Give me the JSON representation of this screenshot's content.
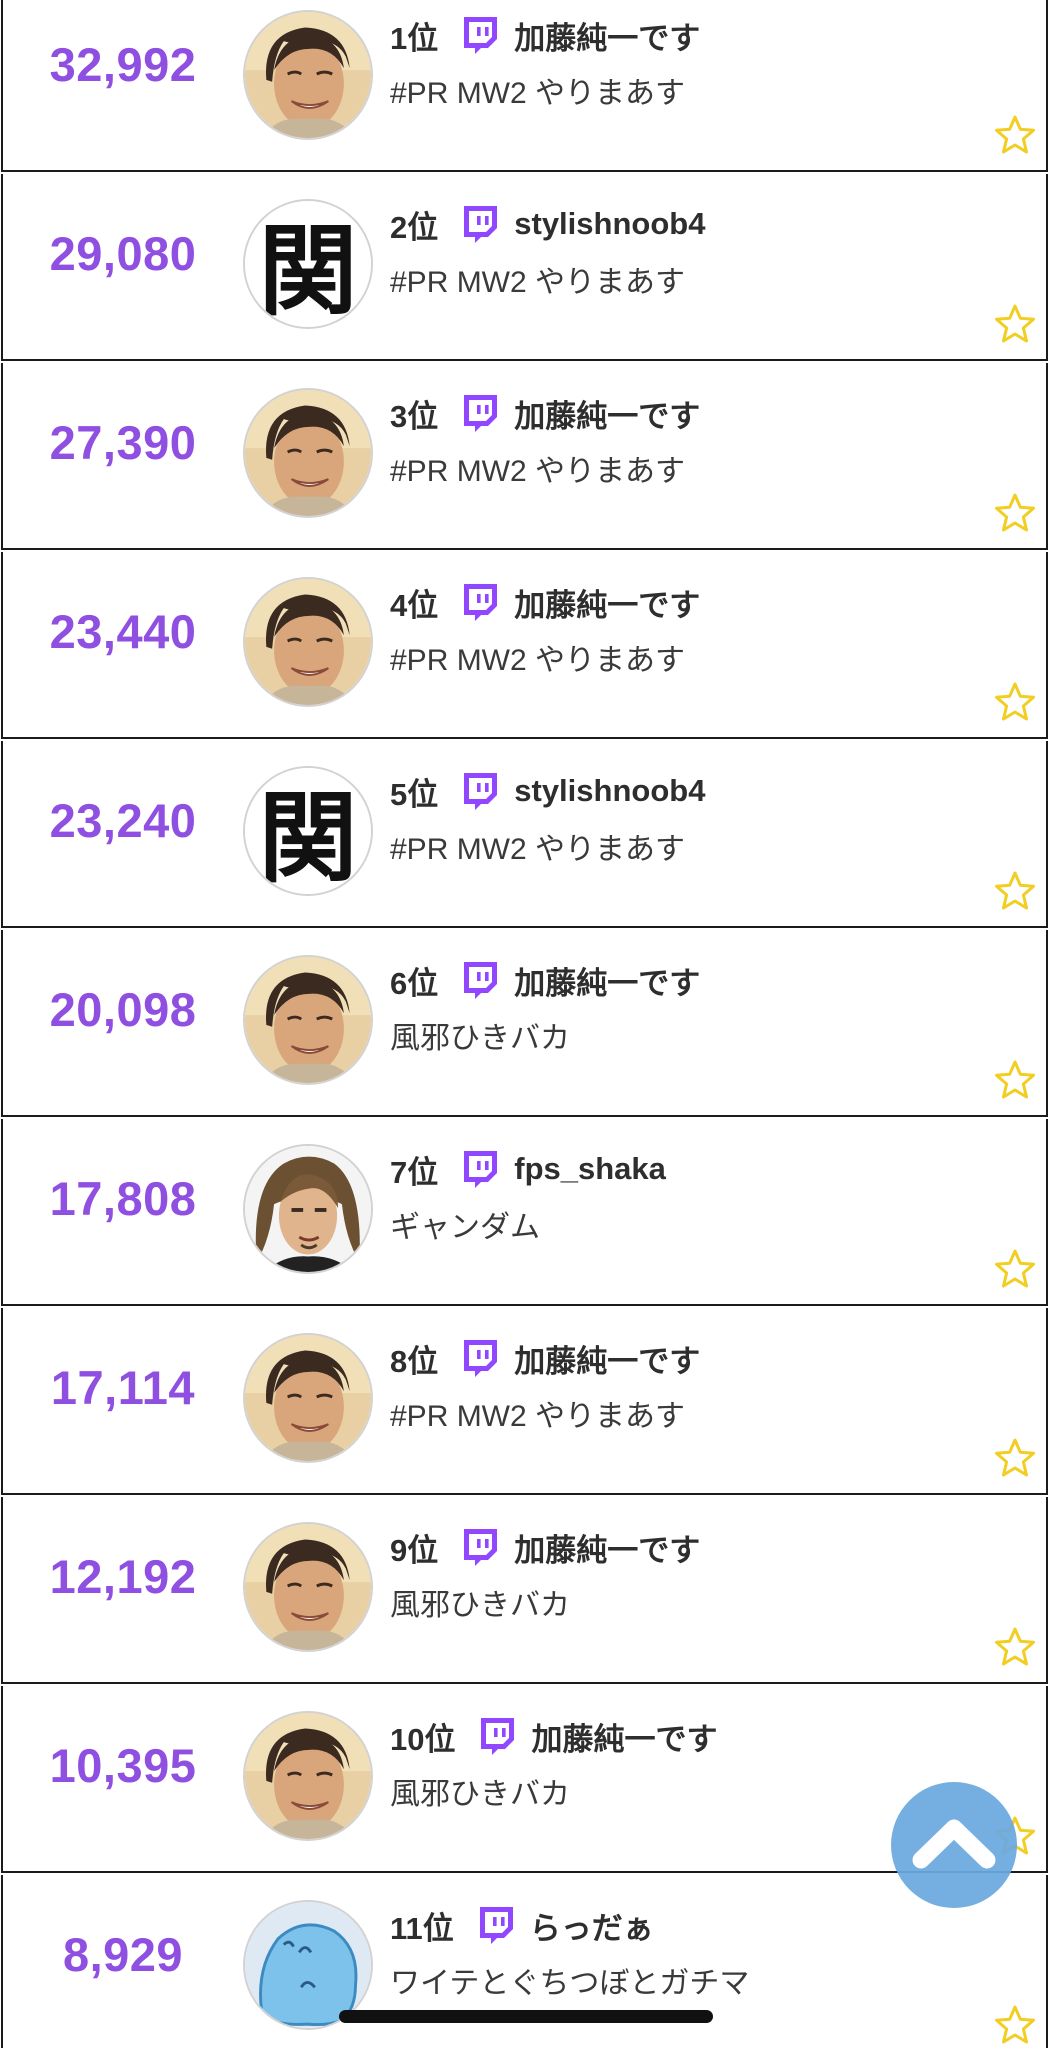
{
  "rows": [
    {
      "viewers": "32,992",
      "rank": "1位",
      "streamer": "加藤純一です",
      "title": "#PR MW2 やりまあす",
      "avatar": "kato-avatar"
    },
    {
      "viewers": "29,080",
      "rank": "2位",
      "streamer": "stylishnoob4",
      "title": "#PR MW2 やりまあす",
      "avatar": "kanji-seki-avatar"
    },
    {
      "viewers": "27,390",
      "rank": "3位",
      "streamer": "加藤純一です",
      "title": "#PR MW2 やりまあす",
      "avatar": "kato-avatar"
    },
    {
      "viewers": "23,440",
      "rank": "4位",
      "streamer": "加藤純一です",
      "title": "#PR MW2 やりまあす",
      "avatar": "kato-avatar"
    },
    {
      "viewers": "23,240",
      "rank": "5位",
      "streamer": "stylishnoob4",
      "title": "#PR MW2 やりまあす",
      "avatar": "kanji-seki-avatar"
    },
    {
      "viewers": "20,098",
      "rank": "6位",
      "streamer": "加藤純一です",
      "title": "風邪ひきバカ",
      "avatar": "kato-avatar"
    },
    {
      "viewers": "17,808",
      "rank": "7位",
      "streamer": "fps_shaka",
      "title": "ギャンダム",
      "avatar": "shaka-avatar"
    },
    {
      "viewers": "17,114",
      "rank": "8位",
      "streamer": "加藤純一です",
      "title": "#PR MW2 やりまあす",
      "avatar": "kato-avatar"
    },
    {
      "viewers": "12,192",
      "rank": "9位",
      "streamer": "加藤純一です",
      "title": "風邪ひきバカ",
      "avatar": "kato-avatar"
    },
    {
      "viewers": "10,395",
      "rank": "10位",
      "streamer": "加藤純一です",
      "title": "風邪ひきバカ",
      "avatar": "kato-avatar"
    },
    {
      "viewers": "8,929",
      "rank": "11位",
      "streamer": "らっだぁ",
      "title": "ワイテとぐちつぼとガチマ",
      "avatar": "blue-ghost-avatar"
    }
  ],
  "row_icons": {
    "platform": "twitch-icon",
    "favorite": "star-outline-icon"
  },
  "controls": {
    "scroll_top": "chevron-up-icon",
    "home_indicator": "home-indicator-bar"
  },
  "colors": {
    "viewer_count": "#8f4fe0",
    "twitch_purple": "#9146ff",
    "star": "#f2cd22",
    "scroll_button": "#6aa8de",
    "row_border": "#1b1b1b"
  }
}
